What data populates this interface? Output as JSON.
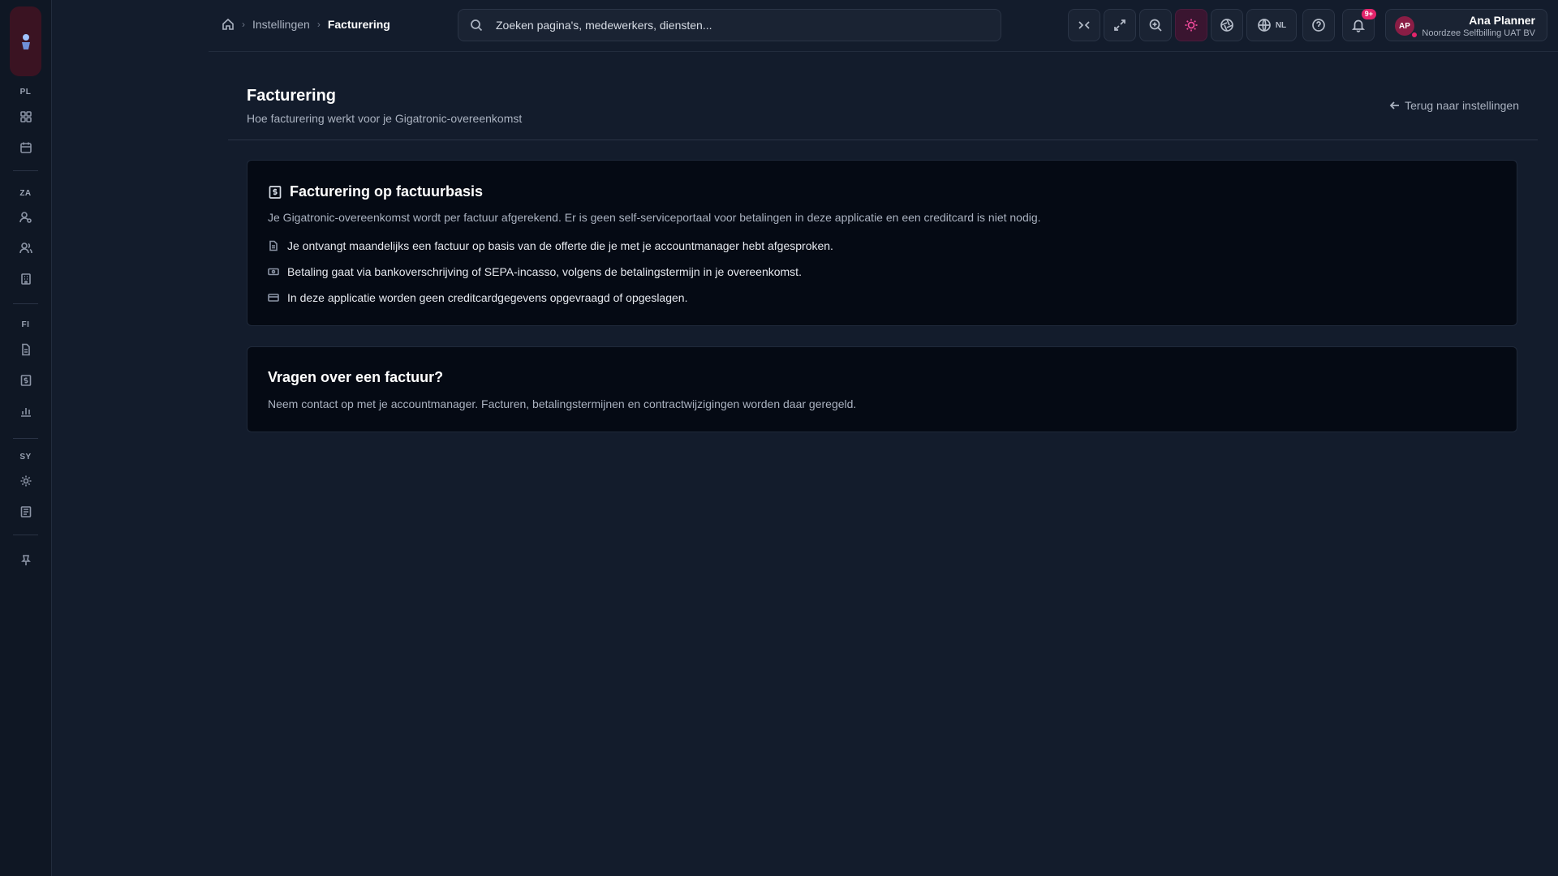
{
  "sidebar": {
    "sections": [
      {
        "label": "PL",
        "items": [
          "dashboard-icon",
          "calendar-icon"
        ]
      },
      {
        "label": "ZA",
        "items": [
          "user-settings-icon",
          "users-icon",
          "building-icon"
        ]
      },
      {
        "label": "FI",
        "items": [
          "document-icon",
          "invoice-icon",
          "chart-icon"
        ]
      },
      {
        "label": "SY",
        "items": [
          "gear-icon",
          "log-icon"
        ]
      }
    ]
  },
  "breadcrumb": {
    "items": [
      "Instellingen",
      "Facturering"
    ]
  },
  "search": {
    "placeholder": "Zoeken pagina's, medewerkers, diensten..."
  },
  "toolbar": {
    "language": "NL",
    "notifications_badge": "9+"
  },
  "user": {
    "initials": "AP",
    "name": "Ana Planner",
    "org": "Noordzee Selfbilling UAT BV"
  },
  "page": {
    "title": "Facturering",
    "subtitle": "Hoe facturering werkt voor je Gigatronic-overeenkomst",
    "back_label": "Terug naar instellingen"
  },
  "card1": {
    "title": "Facturering op factuurbasis",
    "description": "Je Gigatronic-overeenkomst wordt per factuur afgerekend. Er is geen self-serviceportaal voor betalingen in deze applicatie en een creditcard is niet nodig.",
    "bullets": [
      "Je ontvangt maandelijks een factuur op basis van de offerte die je met je accountmanager hebt afgesproken.",
      "Betaling gaat via bankoverschrijving of SEPA-incasso, volgens de betalingstermijn in je overeenkomst.",
      "In deze applicatie worden geen creditcardgegevens opgevraagd of opgeslagen."
    ]
  },
  "card2": {
    "title": "Vragen over een factuur?",
    "description": "Neem contact op met je accountmanager. Facturen, betalingstermijnen en contractwijzigingen worden daar geregeld."
  },
  "colors": {
    "accent": "#e3246b",
    "background": "#131c2c",
    "card": "#050a14"
  }
}
